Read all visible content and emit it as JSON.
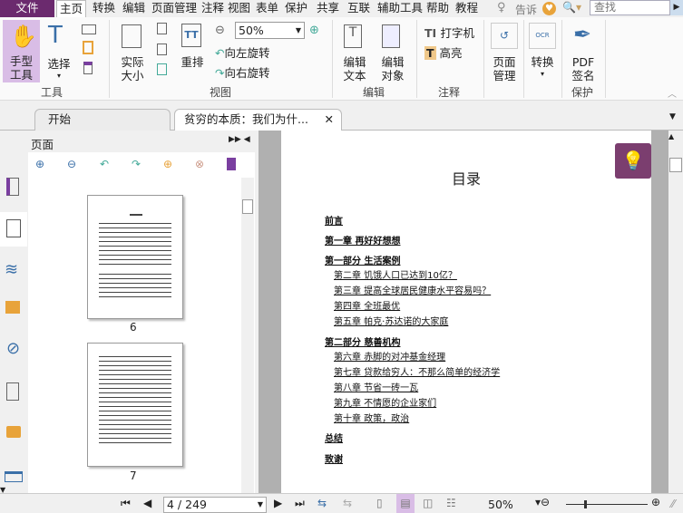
{
  "menubar": {
    "file": "文件",
    "items": [
      "主页",
      "转换",
      "编辑",
      "页面管理",
      "注释",
      "视图",
      "表单",
      "保护",
      "共享",
      "互联",
      "辅助工具",
      "帮助",
      "教程"
    ],
    "tell": "告诉",
    "search_placeholder": "查找"
  },
  "ribbon": {
    "hand": "手型\n工具",
    "select": "选择",
    "actual": "实际\n大小",
    "reflow": "重排",
    "zoom": "50%",
    "rotate_left": "向左旋转",
    "rotate_right": "向右旋转",
    "edit_text": "编辑\n文本",
    "edit_object": "编辑\n对象",
    "typewriter": "打字机",
    "highlight": "高亮",
    "page_mgmt": "页面\n管理",
    "convert": "转换",
    "pdf_sign": "PDF\n签名",
    "groups": [
      "工具",
      "视图",
      "编辑",
      "注释",
      "保护"
    ]
  },
  "tabs": [
    "开始",
    "贫穷的本质：我们为什..."
  ],
  "panel": {
    "title": "页面",
    "pages": [
      "6",
      "7"
    ]
  },
  "document": {
    "title": "目录",
    "toc": [
      {
        "t": "前言",
        "sub": false
      },
      {
        "t": "第一章 再好好想想",
        "sub": false
      },
      {
        "t": "第一部分 生活案例",
        "sub": false
      },
      {
        "t": "第二章 饥饿人口已达到10亿？",
        "sub": true
      },
      {
        "t": "第三章 提高全球居民健康水平容易吗？",
        "sub": true
      },
      {
        "t": "第四章 全班最优",
        "sub": true
      },
      {
        "t": "第五章 帕克·苏达诺的大家庭",
        "sub": true
      },
      {
        "t": "第二部分 慈善机构",
        "sub": false
      },
      {
        "t": "第六章 赤脚的对冲基金经理",
        "sub": true
      },
      {
        "t": "第七章 贷款给穷人：不那么简单的经济学",
        "sub": true
      },
      {
        "t": "第八章 节省一砖一瓦",
        "sub": true
      },
      {
        "t": "第九章 不情愿的企业家们",
        "sub": true
      },
      {
        "t": "第十章 政策，政治",
        "sub": true
      },
      {
        "t": "总结",
        "sub": false
      },
      {
        "t": "致谢",
        "sub": false
      }
    ]
  },
  "status": {
    "page": "4 / 249",
    "zoom": "50%"
  },
  "colors": {
    "accent": "#6b2a6e",
    "hand_bg": "#d9bde6"
  }
}
